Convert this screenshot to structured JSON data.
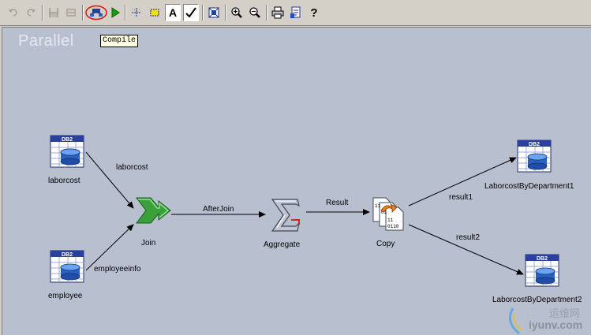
{
  "toolbar": {
    "buttons": [
      {
        "name": "undo-button",
        "icon": "undo-icon",
        "disabled": true
      },
      {
        "name": "redo-button",
        "icon": "redo-icon",
        "disabled": true
      },
      {
        "name": "save-job-button",
        "icon": "save-icon",
        "disabled": true
      },
      {
        "name": "job-properties-button",
        "icon": "properties-icon",
        "disabled": true
      },
      {
        "name": "compile-button",
        "icon": "compile-icon",
        "disabled": false
      },
      {
        "name": "run-button",
        "icon": "run-icon",
        "disabled": false
      },
      {
        "name": "snap-to-grid-button",
        "icon": "grid-icon",
        "disabled": false
      },
      {
        "name": "annotation-button",
        "icon": "annotation-icon",
        "disabled": false
      },
      {
        "name": "show-link-names-button",
        "icon": "text-icon",
        "disabled": false
      },
      {
        "name": "validate-button",
        "icon": "check-icon",
        "disabled": false
      },
      {
        "name": "fit-to-window-button",
        "icon": "fit-window-icon",
        "disabled": false
      },
      {
        "name": "zoom-in-button",
        "icon": "zoom-in-icon",
        "disabled": false
      },
      {
        "name": "zoom-out-button",
        "icon": "zoom-out-icon",
        "disabled": false
      },
      {
        "name": "print-button",
        "icon": "printer-icon",
        "disabled": false
      },
      {
        "name": "report-button",
        "icon": "report-icon",
        "disabled": false
      },
      {
        "name": "help-button",
        "icon": "help-icon",
        "disabled": false
      }
    ],
    "tooltip": "Compile"
  },
  "canvas": {
    "watermark": "Parallel",
    "stages": {
      "laborcost": {
        "label": "laborcost",
        "type": "DB2",
        "icon": "db2-table-icon",
        "badge": "DB2"
      },
      "employee": {
        "label": "employee",
        "type": "DB2",
        "icon": "db2-table-icon",
        "badge": "DB2"
      },
      "join": {
        "label": "Join",
        "type": "Join",
        "icon": "join-arrow-icon"
      },
      "aggregate": {
        "label": "Aggregate",
        "type": "Aggregator",
        "icon": "sigma-icon"
      },
      "copy": {
        "label": "Copy",
        "type": "Copy",
        "icon": "copy-files-icon"
      },
      "target1": {
        "label": "LaborcostByDepartment1",
        "type": "DB2",
        "icon": "db2-table-icon",
        "badge": "DB2"
      },
      "target2": {
        "label": "LaborcostByDepartment2",
        "type": "DB2",
        "icon": "db2-table-icon",
        "badge": "DB2"
      }
    },
    "links": {
      "laborcost": "laborcost",
      "employeeinfo": "employeeinfo",
      "afterjoin": "AfterJoin",
      "result": "Result",
      "result1": "result1",
      "result2": "result2"
    }
  },
  "watermark_logo": {
    "cn": "运维网",
    "en": "iyunv.com"
  }
}
